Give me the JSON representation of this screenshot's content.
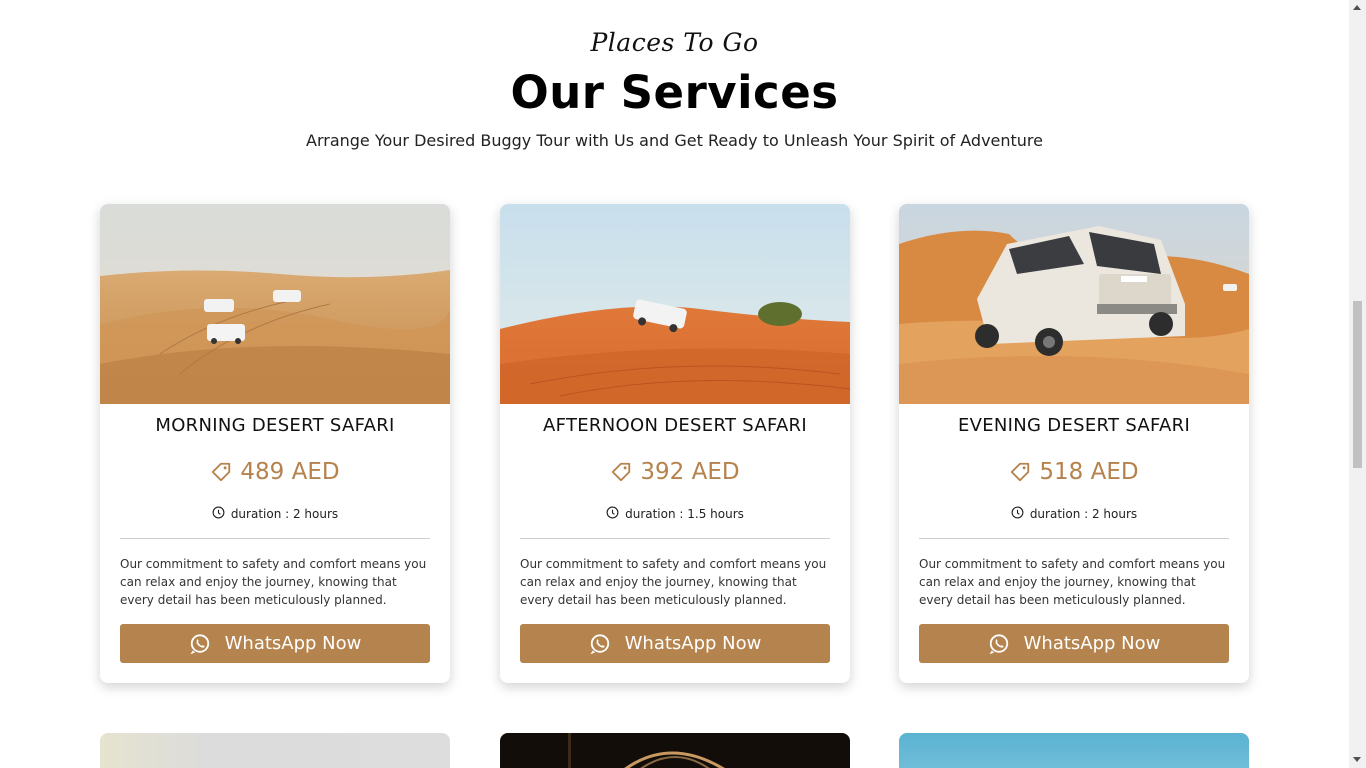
{
  "header": {
    "script_title": "Places To Go",
    "title": "Our Services",
    "subtitle": "Arrange Your Desired Buggy Tour with Us and Get Ready to Unleash Your Spirit of Adventure"
  },
  "cards": [
    {
      "title": "MORNING DESERT SAFARI",
      "price": "489 AED",
      "duration": "duration : 2 hours",
      "description": "Our commitment to safety and comfort means you can relax and enjoy the journey, knowing that every detail has been meticulously planned.",
      "button": "WhatsApp Now"
    },
    {
      "title": "AFTERNOON DESERT SAFARI",
      "price": "392 AED",
      "duration": "duration : 1.5 hours",
      "description": "Our commitment to safety and comfort means you can relax and enjoy the journey, knowing that every detail has been meticulously planned.",
      "button": "WhatsApp Now"
    },
    {
      "title": "EVENING DESERT SAFARI",
      "price": "518 AED",
      "duration": "duration : 2 hours",
      "description": "Our commitment to safety and comfort means you can relax and enjoy the journey, knowing that every detail has been meticulously planned.",
      "button": "WhatsApp Now"
    }
  ],
  "colors": {
    "accent": "#b5834d",
    "price": "#b5824c",
    "background": "#ffffff"
  },
  "icons": {
    "price": "price-tag-icon",
    "duration": "clock-icon",
    "button": "whatsapp-icon"
  }
}
